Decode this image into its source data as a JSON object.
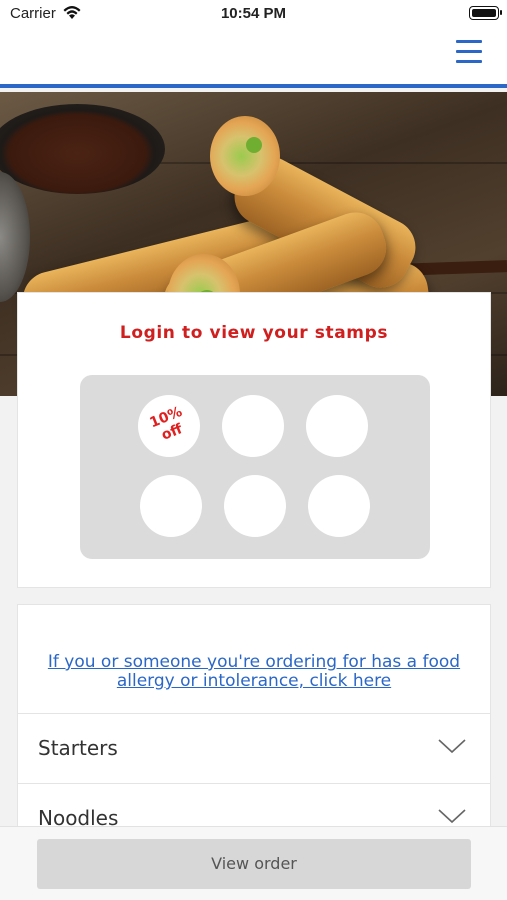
{
  "status_bar": {
    "carrier": "Carrier",
    "time": "10:54 PM"
  },
  "nav": {
    "menu_icon": "hamburger-menu-icon",
    "accent_color": "#2b67c7"
  },
  "loyalty": {
    "title": "Login to view your stamps",
    "stamps": [
      {
        "reward": "10%\noff"
      },
      {
        "reward": ""
      },
      {
        "reward": ""
      },
      {
        "reward": ""
      },
      {
        "reward": ""
      },
      {
        "reward": ""
      }
    ],
    "accent_color": "#cf1f1f"
  },
  "allergy": {
    "link_text": "If you or someone you're ordering for has a food allergy or intolerance, click here"
  },
  "categories": [
    {
      "label": "Starters",
      "icon": "chevron-down-icon"
    },
    {
      "label": "Noodles",
      "icon": "chevron-down-icon"
    }
  ],
  "footer": {
    "view_order_label": "View order"
  }
}
